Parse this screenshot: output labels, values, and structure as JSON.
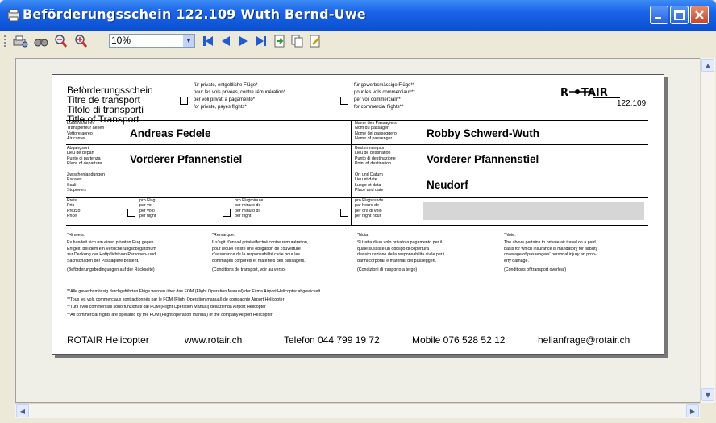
{
  "window": {
    "title": "Beförderungsschein 122.109 Wuth Bernd-Uwe",
    "controls": [
      "minimize",
      "maximize",
      "close"
    ]
  },
  "toolbar": {
    "zoom_value": "10%",
    "icons": [
      "printer-setup-icon",
      "binoculars-icon",
      "zoom-out-icon",
      "zoom-in-icon",
      "first-page-icon",
      "previous-page-icon",
      "next-page-icon",
      "last-page-icon",
      "export-icon",
      "copy-icon",
      "edit-icon"
    ]
  },
  "document": {
    "heading_lines": [
      "Beförderungsschein",
      "Titre de transport",
      "Titolo di transporti",
      "Title of Transport"
    ],
    "private_option_lines": [
      "für private, entgeltliche Flüge*",
      "pour les vols privées, contre rémunération*",
      "per voli privati a pagamento*",
      "for private, payes flights*"
    ],
    "commercial_option_lines": [
      "für gewerbsmässige Flüge**",
      "pour les vols commerciaux**",
      "per voli commerciali**",
      "for commercial flights**"
    ],
    "logo_text": "ROTAIR HELICOPTER",
    "document_number": "122.109",
    "rows": [
      {
        "left_label_lines": [
          "Luftfahrtführer",
          "Transporteur aérien",
          "Vettore aereo",
          "Air carrier"
        ],
        "left_value": "Andreas Fedele",
        "right_label_lines": [
          "Name des Passagiers",
          "Nom du passager",
          "Nome del passeggero",
          "Name of passenger"
        ],
        "right_value": "Robby Schwerd-Wuth"
      },
      {
        "left_label_lines": [
          "Abgangsort",
          "Lieu de départ",
          "Punto di partenza",
          "Place of departure"
        ],
        "left_value": "Vorderer Pfannenstiel",
        "right_label_lines": [
          "Bestimmungsort",
          "Lieu de destination",
          "Punto di destinazione",
          "Point of destination"
        ],
        "right_value": "Vorderer Pfannenstiel"
      },
      {
        "left_label_lines": [
          "Zwischenlandungen",
          "Escales",
          "Scali",
          "Stopovers"
        ],
        "left_value": "",
        "right_label_lines": [
          "Ort und Datum",
          "Lieu et date",
          "Luogo et data",
          "Place and date"
        ],
        "right_value": "Neudorf"
      }
    ],
    "price_labels": [
      "Preis",
      "Prix",
      "Prezzo",
      "Price"
    ],
    "price_options": [
      [
        "pro Flug",
        "par vol",
        "per volo",
        "per flight"
      ],
      [
        "pro Flugminute",
        "par minute de",
        "per minuto di",
        "per flight"
      ],
      [
        "pro Flugstunde",
        "par heure de",
        "per ora di volo",
        "per flight hour"
      ]
    ],
    "notes": [
      {
        "heading": "*Hinweis:",
        "lines": [
          "Es handelt sich um einen privaten Flug gegen",
          "Entgelt, bei dem ein Versicherungsobligatorium",
          "zur Deckung der Haftpflicht von Personen- und",
          "Sachschäden der Passagiere besteht."
        ],
        "footer": "(Beförderungsbedingungen auf der Rückseite)"
      },
      {
        "heading": "*Remarque:",
        "lines": [
          "Il s'agit d'un vol privé effectué contre rémunération,",
          "pour lequel existe une obligation de couverture",
          "d'assurance de la responsabilité civile pour les",
          "dommages corporels et matériels des passagers."
        ],
        "footer": "(Conditions de transport, voir au verso)"
      },
      {
        "heading": "*Nota:",
        "lines": [
          "Si tratta di un volo privato a pagamento per il",
          "quale sussiste un obbligo di copertura",
          "d'assicurazione della responsabilità civile per i",
          "danni corporali e materiali dei passeggeri."
        ],
        "footer": "(Condizioni di trasporto a tergo)"
      },
      {
        "heading": "*Note:",
        "lines": [
          "The above pertains to private air travel on a paid",
          "basis for which insurance is mandatory for liability",
          "coverage of passengers' personal injury an prop-",
          "erty damage."
        ],
        "footer": "(Conditions of transport overleaf)"
      }
    ],
    "commercial_notes": [
      "**Alle gewerbsmässig durchgeführten Flüge werden über das FOM (Flight Operation Manual) der Firma Airport Helicopter abgewickelt",
      "**Tous les vols commerciaux sont actionnés par le FOM (Flight Operation manual) de compagnie Airport Helicopter",
      "**Tutti i voli commerciali sono funzionati dal FOM (Flight Operation Manual) dellazienda Airport Helicopter",
      "**All commercial flights are operated by the FOM (Flight operation manual) of the company Airport Helicopter"
    ],
    "footer": {
      "company": "ROTAIR Helicopter",
      "website": "www.rotair.ch",
      "phone": "Telefon 044 799 19 72",
      "mobile": "Mobile 076 528 52 12",
      "email": "helianfrage@rotair.ch"
    }
  }
}
